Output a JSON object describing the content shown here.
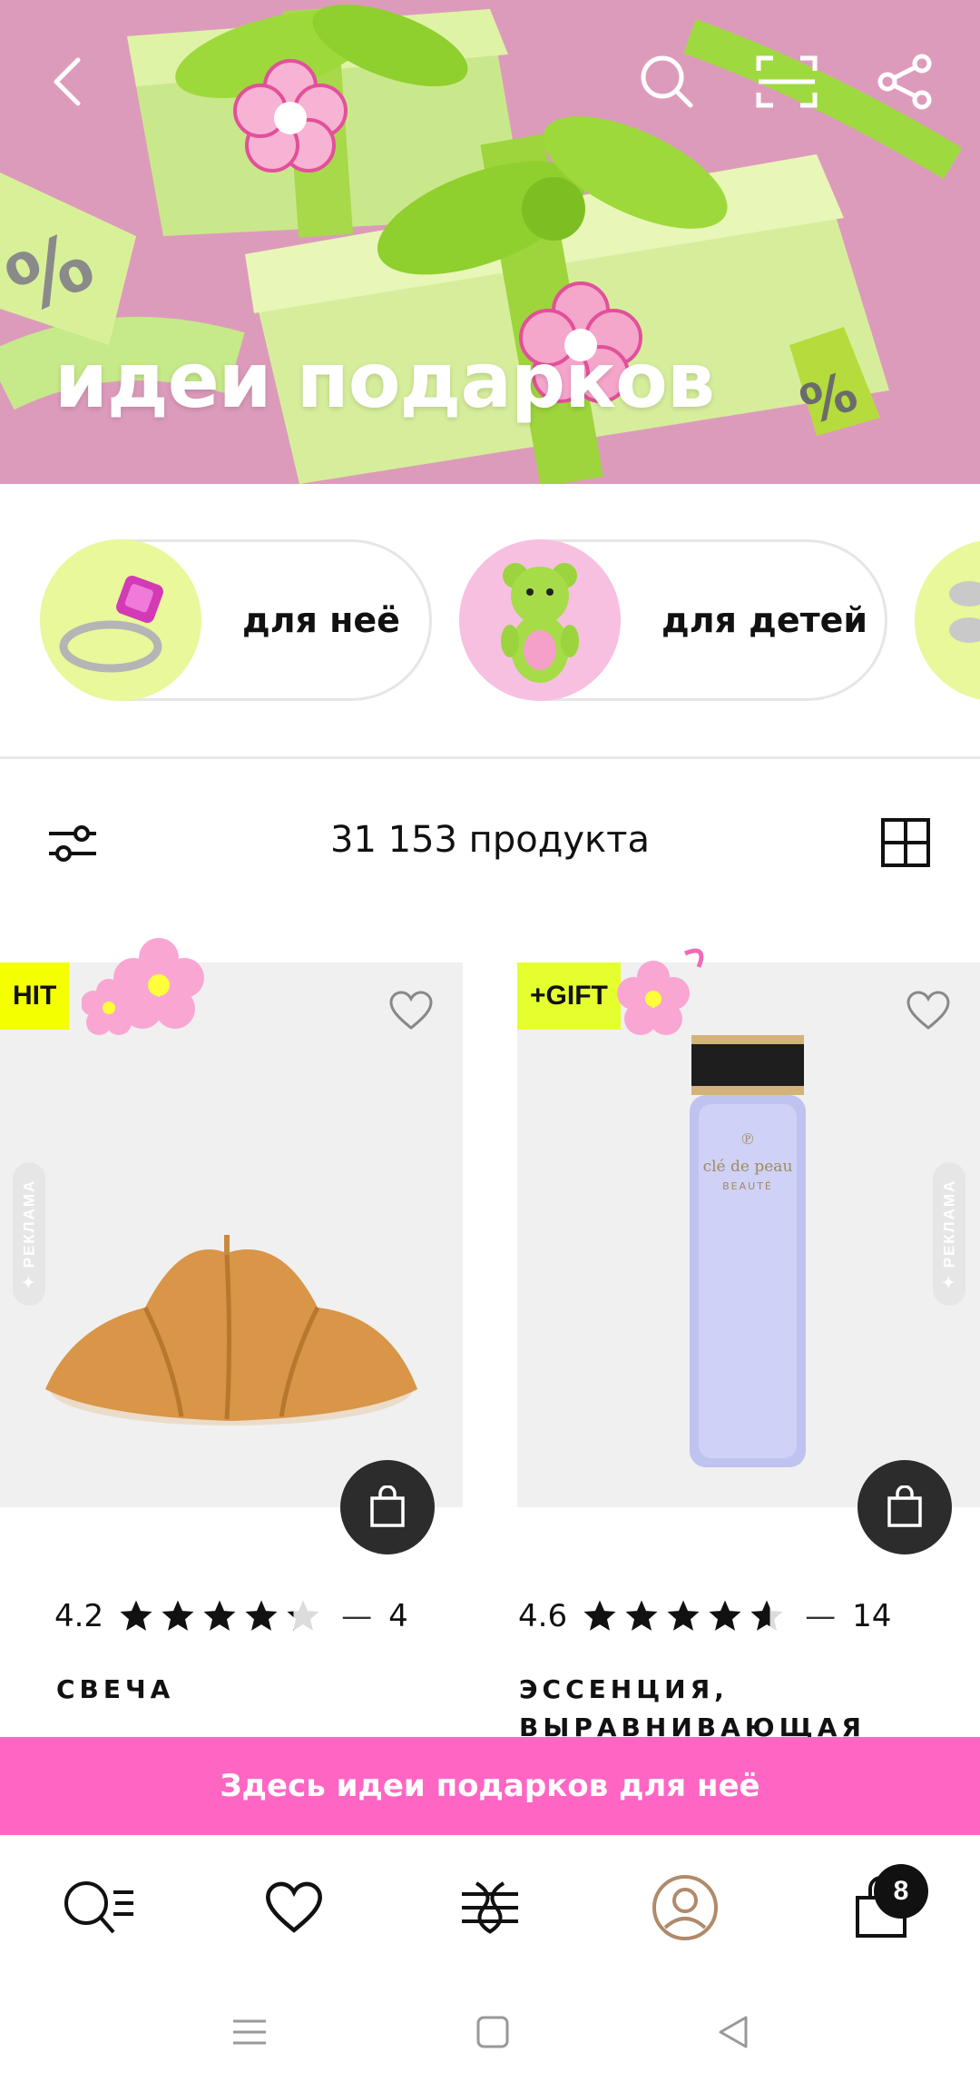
{
  "hero": {
    "title": "идеи подарков",
    "badge_percent_symbol": "%"
  },
  "categories": [
    {
      "label": "для неё",
      "icon": "ring-icon"
    },
    {
      "label": "для детей",
      "icon": "teddy-bear-icon"
    },
    {
      "label": "",
      "icon": "partial-category-icon"
    }
  ],
  "toolbar": {
    "count_label": "31 153 продукта"
  },
  "products": [
    {
      "badge": "HIT",
      "badge_color": "#f4ff00",
      "ad_label": "✦ РЕКЛАМА",
      "rating": "4.2",
      "stars": 4.2,
      "reviews": "4",
      "name": "СВЕЧА"
    },
    {
      "badge": "+GIFT",
      "badge_color": "#e5ff2e",
      "ad_label": "✦ РЕКЛАМА",
      "rating": "4.6",
      "stars": 4.6,
      "reviews": "14",
      "name": "ЭССЕНЦИЯ, ВЫРАВНИВАЮЩАЯ ПОВЕ…"
    }
  ],
  "promo": {
    "label": "Здесь идеи подарков для неё",
    "color": "#ff66c4"
  },
  "bottom_nav": {
    "cart_count": "8"
  },
  "bottle_text": {
    "brand": "clé de peau",
    "sub": "BEAUTÉ"
  }
}
